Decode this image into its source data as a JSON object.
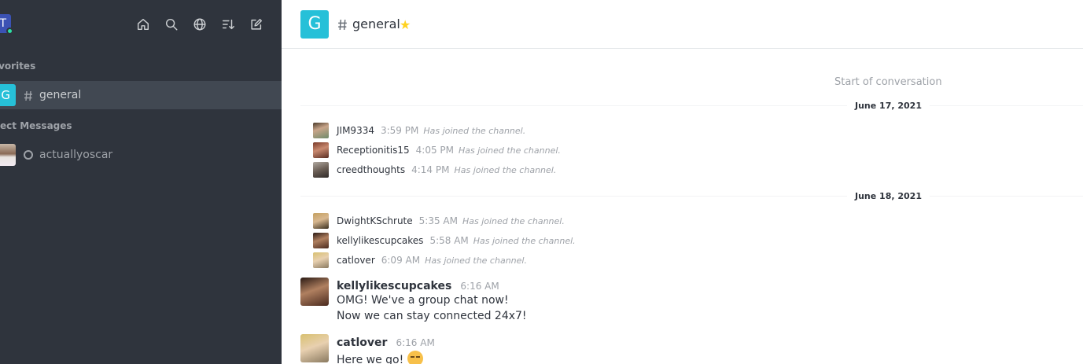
{
  "sidebar": {
    "user_initial": "T",
    "tools": [
      "home-icon",
      "search-icon",
      "globe-icon",
      "sort-icon",
      "edit-icon"
    ],
    "sections": {
      "favorites": "avorites",
      "direct_messages": "irect Messages"
    },
    "rooms": [
      {
        "avatar_letter": "G",
        "type": "channel",
        "label": "general",
        "active": true
      },
      {
        "type": "direct",
        "label": "actuallyoscar",
        "status": "offline"
      }
    ]
  },
  "header": {
    "avatar_letter": "G",
    "title": "general",
    "favorite": true
  },
  "conversation": {
    "start_text": "Start of conversation",
    "dates": [
      "June 17, 2021",
      "June 18, 2021"
    ],
    "system_messages": [
      {
        "user": "JIM9334",
        "time": "3:59 PM",
        "text": "Has joined the channel."
      },
      {
        "user": "Receptionitis15",
        "time": "4:05 PM",
        "text": "Has joined the channel."
      },
      {
        "user": "creedthoughts",
        "time": "4:14 PM",
        "text": "Has joined the channel."
      },
      {
        "user": "DwightKSchrute",
        "time": "5:35 AM",
        "text": "Has joined the channel."
      },
      {
        "user": "kellylikescupcakes",
        "time": "5:58 AM",
        "text": "Has joined the channel."
      },
      {
        "user": "catlover",
        "time": "6:09 AM",
        "text": "Has joined the channel."
      }
    ],
    "messages": [
      {
        "user": "kellylikescupcakes",
        "time": "6:16 AM",
        "lines": [
          "OMG! We've a group chat now!",
          "Now we can stay connected 24x7!"
        ]
      },
      {
        "user": "catlover",
        "time": "6:16 AM",
        "lines": [
          "Here we go!"
        ],
        "emoji": "unamused-face-icon"
      }
    ]
  },
  "colors": {
    "sidebar_bg": "#2f343d",
    "active_item_bg": "#414852",
    "channel_avatar": "#26c0d8",
    "star": "#ffd21f",
    "online": "#2de0a5"
  }
}
